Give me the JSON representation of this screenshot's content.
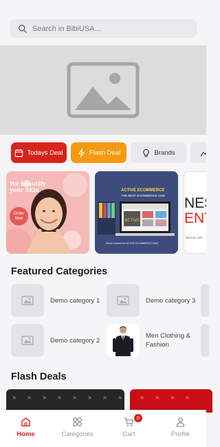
{
  "search": {
    "placeholder": "Search in BibiUSA..."
  },
  "quick_links": [
    {
      "label": "Todays Deal",
      "icon": "calendar-icon",
      "color": "#d9231d"
    },
    {
      "label": "Flash Deal",
      "icon": "lightning-icon",
      "color": "#f59a12"
    },
    {
      "label": "Brands",
      "icon": "lightbulb-icon",
      "color": "#e8e8ed"
    }
  ],
  "promos": {
    "beauty": {
      "title_line1": "We beautify",
      "title_line2": "your Skin",
      "badge": "Order Now"
    },
    "ecommerce": {
      "headline": "ACTIVE ECOMMERCE",
      "subline": "THE BEST ECOMMERCE CMS",
      "brand": "ACTIVE",
      "caption": "Demo Content for ACTIVE ECOMMERCE CMS"
    },
    "business": {
      "line1": "NESS",
      "line2": "ENT",
      "line3": "MERCE CMS"
    }
  },
  "featured": {
    "title": "Featured Categories",
    "items": [
      {
        "label": "Demo category 1"
      },
      {
        "label": "Demo category 2"
      },
      {
        "label": "Demo category 3"
      },
      {
        "label": "Men Clothing & Fashion"
      }
    ]
  },
  "flash_deals": {
    "title": "Flash Deals"
  },
  "nav": {
    "items": [
      {
        "label": "Home",
        "icon": "home-icon"
      },
      {
        "label": "Categories",
        "icon": "grid-icon"
      },
      {
        "label": "Cart",
        "icon": "cart-icon"
      },
      {
        "label": "Profile",
        "icon": "person-icon"
      }
    ],
    "active": "Home",
    "cart_count": "0"
  },
  "colors": {
    "accent": "#d6231c",
    "flash": "#f59a12",
    "placeholder": "#dcdcdc"
  }
}
